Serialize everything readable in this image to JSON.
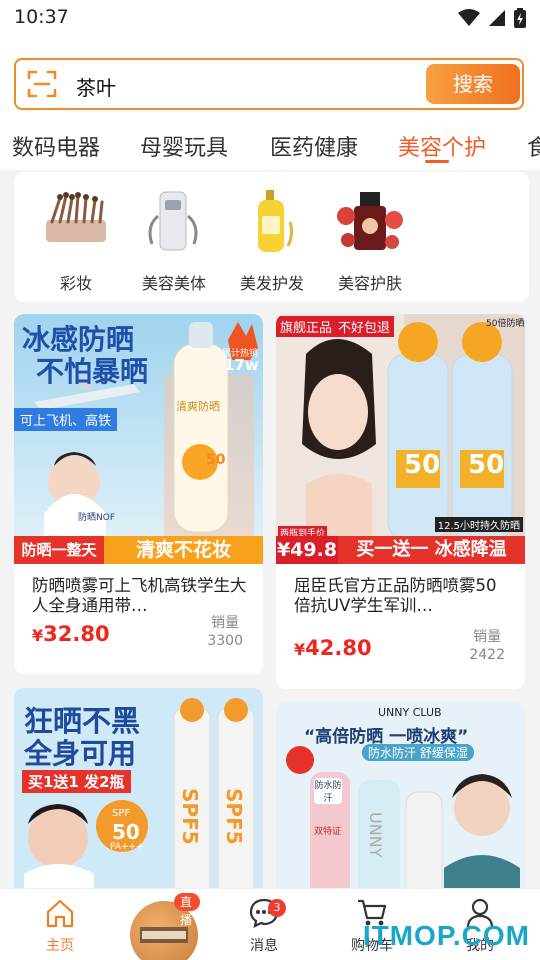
{
  "status": {
    "time": "10:37"
  },
  "search": {
    "query": "茶叶",
    "button": "搜索"
  },
  "tabs": [
    "数码电器",
    "母婴玩具",
    "医药健康",
    "美容个护",
    "食"
  ],
  "categories": [
    {
      "label": "彩妆",
      "icon": "brush-set-icon"
    },
    {
      "label": "美容美体",
      "icon": "beauty-device-icon"
    },
    {
      "label": "美发护发",
      "icon": "shampoo-bottle-icon"
    },
    {
      "label": "美容护肤",
      "icon": "essential-oil-icon"
    }
  ],
  "products": [
    {
      "title": "防晒喷雾可上飞机高铁学生大人全身通用带…",
      "price_symbol": "¥",
      "price": "32.80",
      "sales_label": "销量",
      "sales": "3300",
      "img": {
        "headline1": "冰感防晒",
        "headline2": "不怕暴晒",
        "sold_tag": "累计热销",
        "sold_num": "17w",
        "travel_tag": "可上飞机、高铁",
        "brand": "防晒NOF",
        "bottle_text": "清爽防晒",
        "spf": "50",
        "bottom_left": "防晒一整天",
        "bottom_right": "清爽不花妆"
      }
    },
    {
      "title": "屈臣氏官方正品防晒喷雾50倍抗UV学生军训…",
      "price_symbol": "¥",
      "price": "42.80",
      "sales_label": "销量",
      "sales": "2422",
      "img": {
        "tag1": "旗舰正品",
        "tag2": "不好包退",
        "corner": "50倍防晒",
        "spf1": "50",
        "spf2": "50",
        "duration": "12.5小时持久防晒",
        "price_tag": "两瓶到手价",
        "price_tag_num": "¥49.8",
        "bottom": "买一送一 冰感降温"
      }
    },
    {
      "img": {
        "headline1": "狂晒不黑",
        "headline2": "全身可用",
        "promo": "买1送1  发2瓶",
        "spf_label": "SPF",
        "spf": "50",
        "pa": "PA+++",
        "bottle": "SPF5"
      }
    },
    {
      "img": {
        "brand": "UNNY CLUB",
        "headline": "“高倍防晒  一喷冰爽”",
        "sub": "防水防汗 舒缓保湿",
        "tag1": "防水防汗",
        "tag2": "双特证",
        "bottle": "UNNY"
      }
    }
  ],
  "nav": {
    "home": "主页",
    "live": "直播",
    "messages": "消息",
    "messages_badge": "3",
    "cart": "购物车",
    "me": "我的"
  },
  "watermark": "ITMOP.COM"
}
